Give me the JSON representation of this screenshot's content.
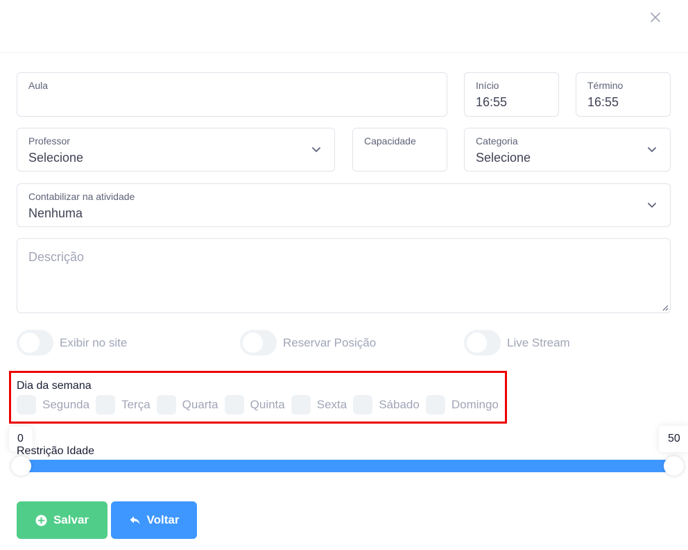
{
  "form": {
    "aula": {
      "label": "Aula",
      "value": ""
    },
    "inicio": {
      "label": "Início",
      "value": "16:55"
    },
    "termino": {
      "label": "Término",
      "value": "16:55"
    },
    "professor": {
      "label": "Professor",
      "value": "Selecione"
    },
    "capacidade": {
      "label": "Capacidade",
      "value": ""
    },
    "categoria": {
      "label": "Categoria",
      "value": "Selecione"
    },
    "atividade": {
      "label": "Contabilizar na atividade",
      "value": "Nenhuma"
    },
    "descricao": {
      "placeholder": "Descrição"
    }
  },
  "toggles": [
    {
      "label": "Exibir no site",
      "checked": false
    },
    {
      "label": "Reservar Posição",
      "checked": false
    },
    {
      "label": "Live Stream",
      "checked": false
    }
  ],
  "week": {
    "title": "Dia da semana",
    "days": [
      {
        "label": "Segunda",
        "checked": false
      },
      {
        "label": "Terça",
        "checked": false
      },
      {
        "label": "Quarta",
        "checked": false
      },
      {
        "label": "Quinta",
        "checked": false
      },
      {
        "label": "Sexta",
        "checked": false
      },
      {
        "label": "Sábado",
        "checked": false
      },
      {
        "label": "Domingo",
        "checked": false
      }
    ]
  },
  "age_restriction": {
    "title": "Restrição Idade",
    "min": "0",
    "max": "50"
  },
  "buttons": {
    "save": "Salvar",
    "back": "Voltar"
  },
  "colors": {
    "primary": "#3e97ff",
    "success": "#50cd89",
    "highlight": "#ec0000"
  }
}
